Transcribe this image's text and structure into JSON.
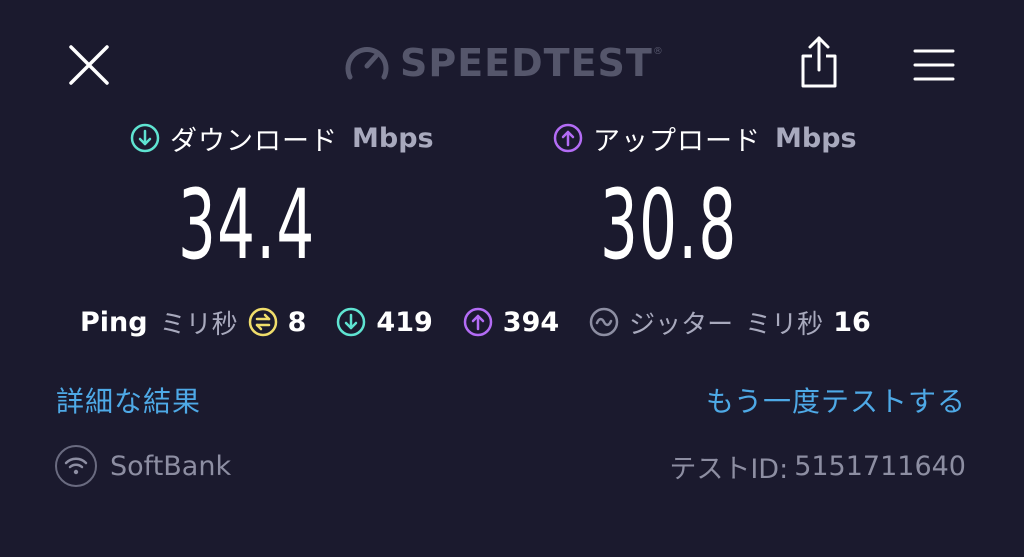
{
  "header": {
    "logo_text": "SPEEDTEST",
    "logo_tm": "®",
    "icons": [
      "close-icon",
      "speedometer-icon",
      "share-icon",
      "menu-icon"
    ]
  },
  "download": {
    "label": "ダウンロード",
    "unit": "Mbps",
    "value": "34.4",
    "icon": "download-arrow-icon",
    "color": "#5fe3d1"
  },
  "upload": {
    "label": "アップロード",
    "unit": "Mbps",
    "value": "30.8",
    "icon": "upload-arrow-icon",
    "color": "#b36cf5"
  },
  "ping": {
    "label": "Ping",
    "unit": "ミリ秒",
    "idle_value": "8",
    "idle_color": "#f0dd6b",
    "download_value": "419",
    "upload_value": "394",
    "jitter_label": "ジッター",
    "jitter_unit": "ミリ秒",
    "jitter_value": "16",
    "jitter_color": "#8d8ea2"
  },
  "links": {
    "details": "詳細な結果",
    "retest": "もう一度テストする"
  },
  "footer": {
    "provider": "SoftBank",
    "provider_icon": "wifi-icon",
    "test_id_label": "テストID:",
    "test_id_value": "5151711640"
  },
  "colors": {
    "background": "#1b1a2e",
    "link": "#4ea9e6",
    "muted": "#8d8ea2"
  }
}
